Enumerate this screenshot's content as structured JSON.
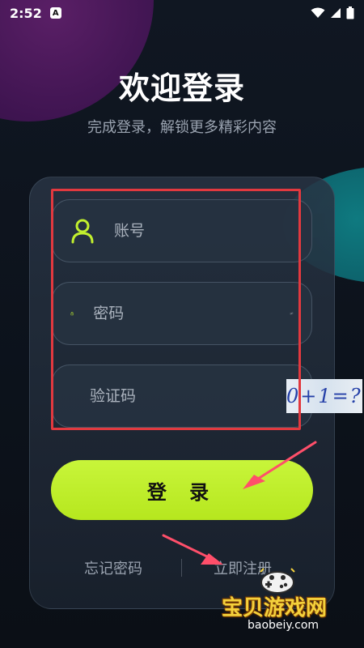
{
  "status_bar": {
    "time": "2:52",
    "indicator": "A"
  },
  "header": {
    "title": "欢迎登录",
    "subtitle": "完成登录，解锁更多精彩内容"
  },
  "form": {
    "account_placeholder": "账号",
    "password_placeholder": "密码",
    "captcha_placeholder": "验证码",
    "captcha_text": "0+1=?"
  },
  "actions": {
    "login_label": "登 录",
    "forgot_label": "忘记密码",
    "register_label": "立即注册"
  },
  "watermark": {
    "text": "宝贝游戏网",
    "url": "baobeiy.com"
  },
  "colors": {
    "accent": "#c2f02e",
    "highlight": "#e2393f",
    "annotation_arrow": "#ff4f6a"
  },
  "icons": {
    "account": "user-icon",
    "password": "lock-icon",
    "captcha": "shield-check-icon",
    "visibility": "eye-off-icon"
  }
}
